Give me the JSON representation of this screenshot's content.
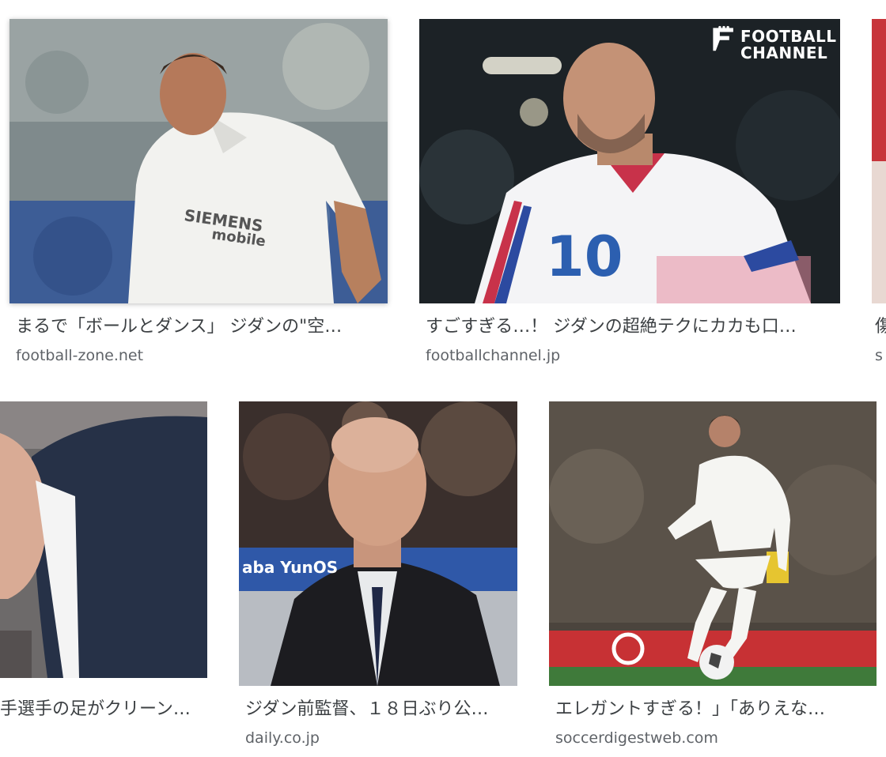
{
  "results": [
    {
      "title": "まるで「ボールとダンス」 ジダンの\"空…",
      "source": "football-zone.net",
      "jersey_sponsor": "SIEMENS mobile"
    },
    {
      "title": "すごすぎる…！ ジダンの超絶テクにカカも口…",
      "source": "footballchannel.jp",
      "logo_line1": "FOOTBALL",
      "logo_line2": "CHANNEL",
      "jersey_number": "10"
    },
    {
      "title": "傷",
      "source": "s"
    },
    {
      "title": "手選手の足がクリーン…",
      "source": ""
    },
    {
      "title": "ジダン前監督、１８日ぶり公…",
      "source": "daily.co.jp",
      "banner_text": "aba YunOS"
    },
    {
      "title": "エレガントすぎる！」「ありえな…",
      "source": "soccerdigestweb.com"
    }
  ],
  "colors": {
    "title_text": "#3c4043",
    "source_text": "#5f6368",
    "background": "#ffffff"
  }
}
